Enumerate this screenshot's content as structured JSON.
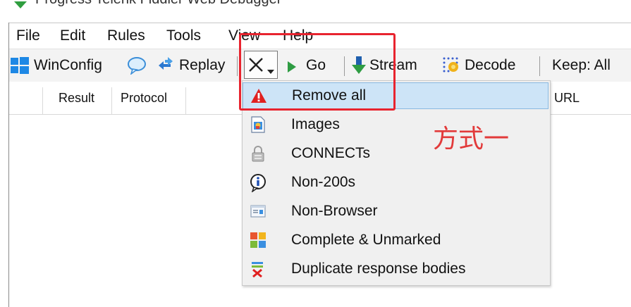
{
  "window": {
    "title": "Progress Telerik Fiddler Web Debugger"
  },
  "menubar": {
    "items": [
      "File",
      "Edit",
      "Rules",
      "Tools",
      "View",
      "Help"
    ]
  },
  "toolbar": {
    "winconfig": "WinConfig",
    "replay": "Replay",
    "remove_dropdown_glyph": "✕",
    "go": "Go",
    "stream": "Stream",
    "decode": "Decode",
    "keep": "Keep: All"
  },
  "session_list": {
    "columns": [
      "Result",
      "Protocol",
      "URL"
    ]
  },
  "remove_menu": {
    "items": [
      {
        "label": "Remove all",
        "icon": "warning-icon",
        "highlighted": true
      },
      {
        "label": "Images",
        "icon": "image-file-icon"
      },
      {
        "label": "CONNECTs",
        "icon": "lock-icon"
      },
      {
        "label": "Non-200s",
        "icon": "info-icon"
      },
      {
        "label": "Non-Browser",
        "icon": "window-icon"
      },
      {
        "label": "Complete & Unmarked",
        "icon": "colored-squares-icon"
      },
      {
        "label": "Duplicate response bodies",
        "icon": "duplicate-remove-icon"
      }
    ]
  },
  "annotation": {
    "note": "方式一",
    "color": "#e8242f"
  },
  "colors": {
    "highlight": "#cde4f7",
    "highlight_border": "#88b8e0",
    "menu_bg": "#f0f0f0",
    "toolbar_bg": "#f3f3f3"
  }
}
